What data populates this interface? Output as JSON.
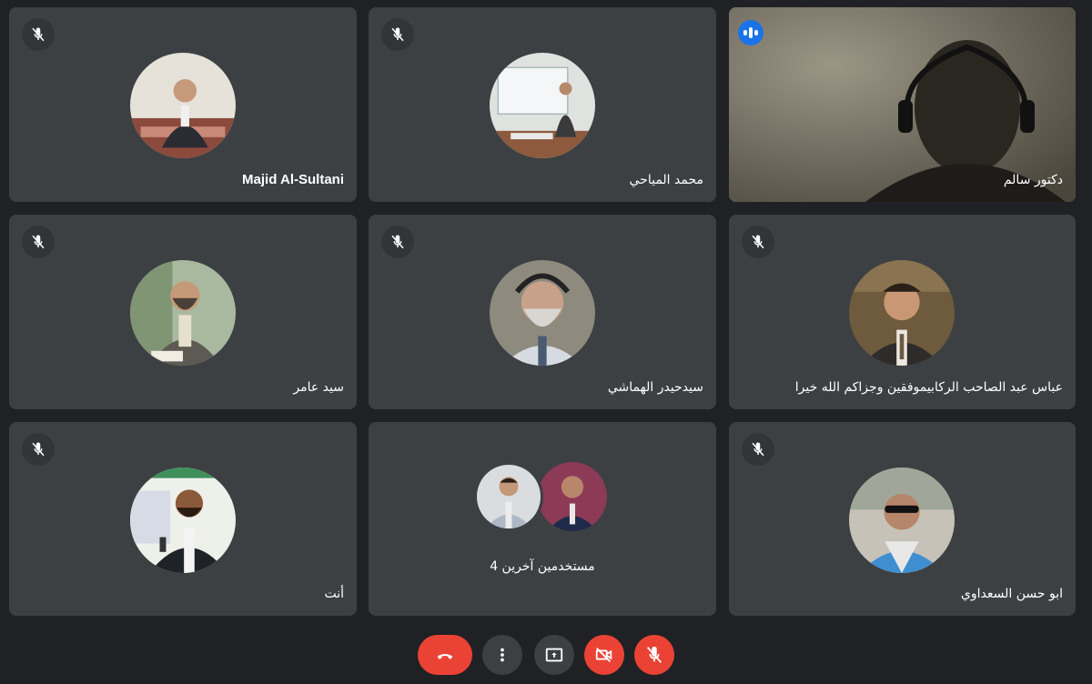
{
  "participants": [
    {
      "name": "Majid Al-Sultani"
    },
    {
      "name": "محمد المياحي"
    },
    {
      "name": "دكتور سالم"
    },
    {
      "name": "سيد عامر"
    },
    {
      "name": "سيدحيدر الهماشي"
    },
    {
      "name": "عباس عبد الصاحب الركابيموفقين وجزاكم الله خيرا"
    },
    {
      "name": "أنت"
    },
    {
      "name": "4 مستخدمين آخرين"
    },
    {
      "name": "ابو حسن السعداوي"
    }
  ],
  "colors": {
    "background": "#202124",
    "tile": "#3c4043",
    "active_speaker_border": "#8ab4f8",
    "danger": "#ea4335"
  },
  "controls": {
    "items": [
      "end-call",
      "more-options",
      "present-screen",
      "camera-off",
      "mic-off"
    ]
  }
}
